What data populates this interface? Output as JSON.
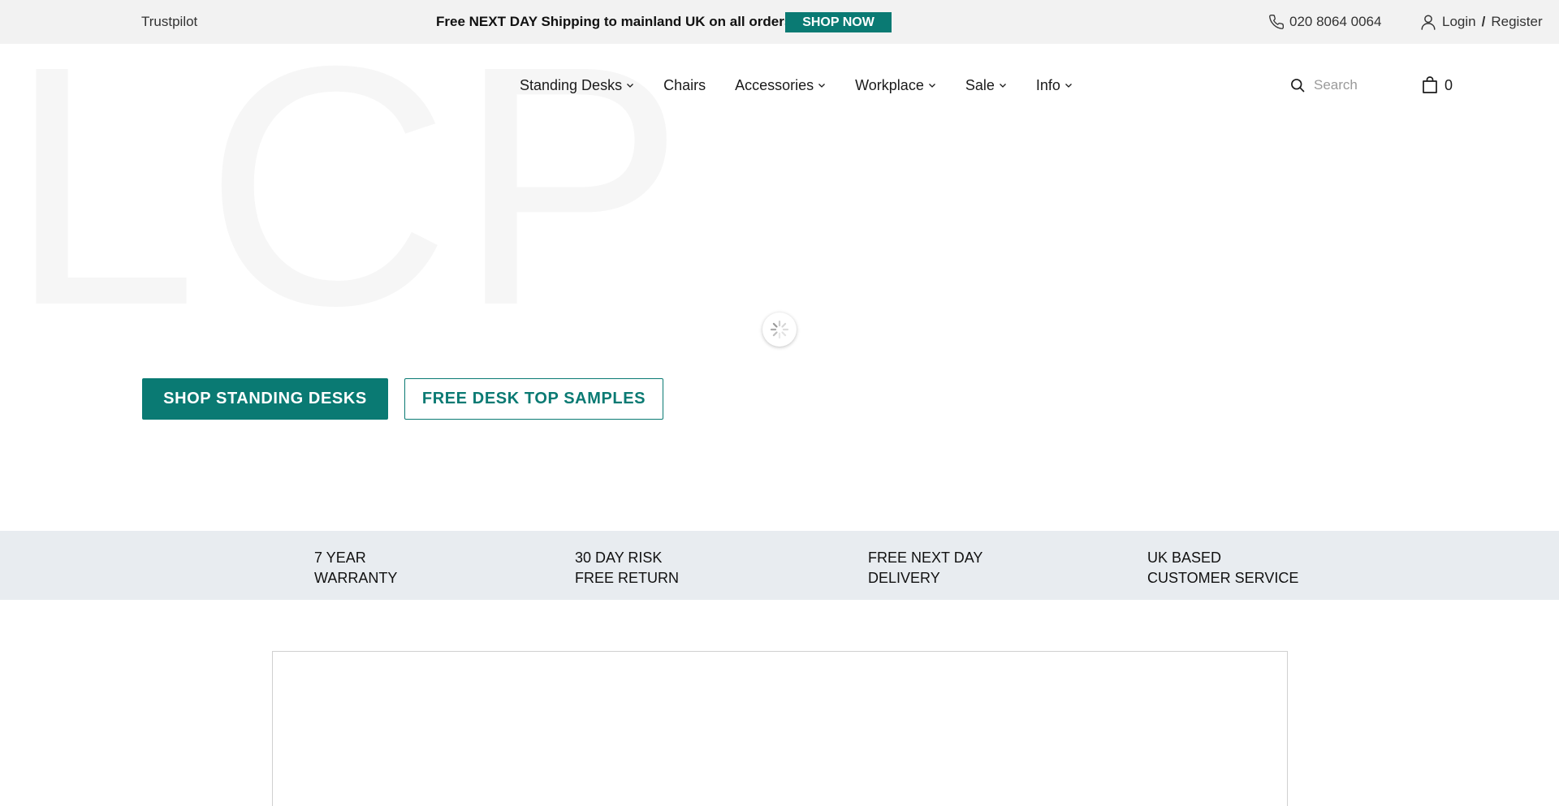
{
  "topbar": {
    "trustpilot": "Trustpilot",
    "promo": "Free NEXT DAY Shipping to mainland UK on all orders",
    "shop_now": "SHOP NOW",
    "phone": "020 8064 0064",
    "login": "Login",
    "separator": "/",
    "register": "Register"
  },
  "watermark": "LCP",
  "nav": {
    "items": [
      {
        "label": "Standing Desks",
        "dropdown": true
      },
      {
        "label": "Chairs",
        "dropdown": false
      },
      {
        "label": "Accessories",
        "dropdown": true
      },
      {
        "label": "Workplace",
        "dropdown": true
      },
      {
        "label": "Sale",
        "dropdown": true
      },
      {
        "label": "Info",
        "dropdown": true
      }
    ],
    "search_placeholder": "Search",
    "cart_count": "0"
  },
  "hero": {
    "primary_cta": "SHOP STANDING DESKS",
    "secondary_cta": "FREE DESK TOP SAMPLES"
  },
  "usp": [
    {
      "line1": "7 YEAR",
      "line2": "WARRANTY"
    },
    {
      "line1": "30 DAY RISK",
      "line2": "FREE RETURN"
    },
    {
      "line1": "FREE NEXT DAY",
      "line2": "DELIVERY"
    },
    {
      "line1": "UK BASED",
      "line2": "CUSTOMER SERVICE"
    }
  ],
  "colors": {
    "brand_teal": "#0a7a73",
    "topbar_bg": "#f2f2f2",
    "usp_bg": "#e8ecf0"
  },
  "icons": [
    "phone-icon",
    "user-icon",
    "search-icon",
    "shopping-bag-icon",
    "chevron-down-icon",
    "loading-spinner-icon"
  ]
}
